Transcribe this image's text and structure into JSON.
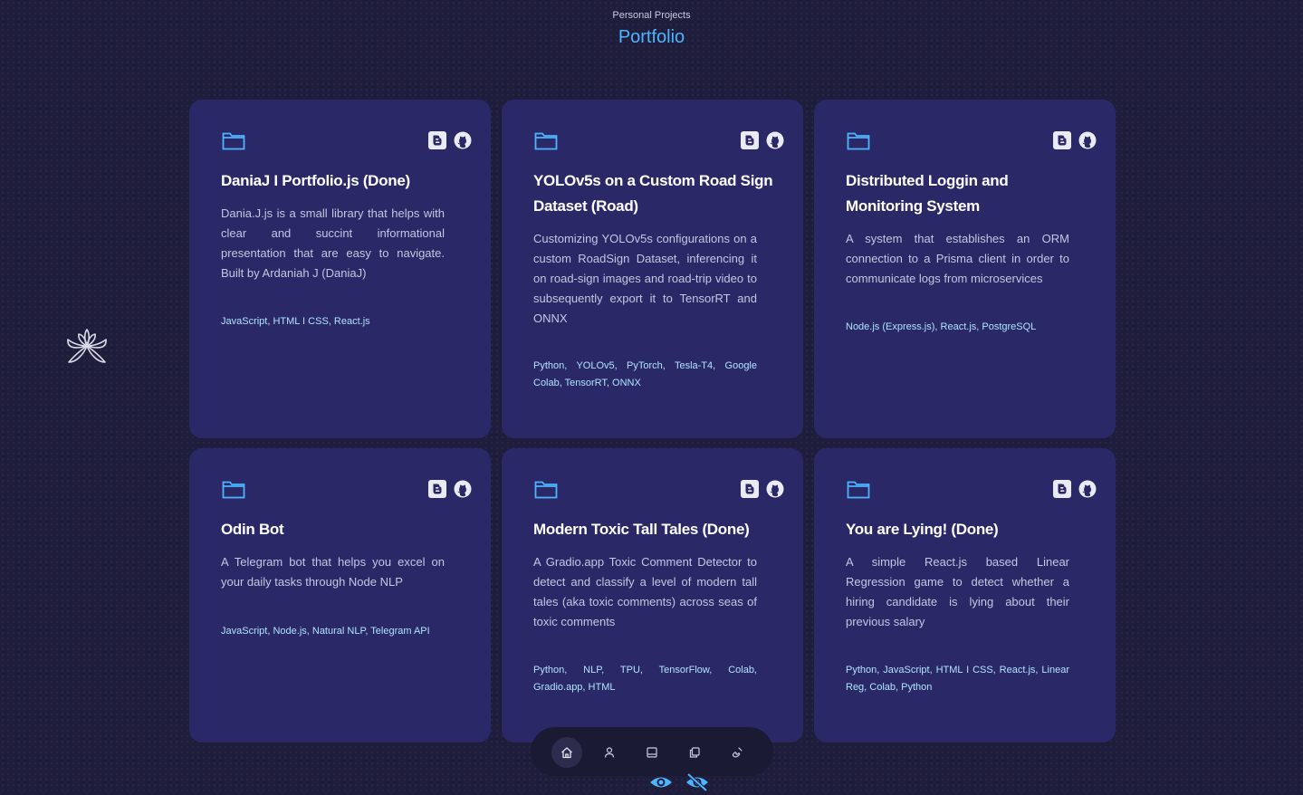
{
  "header": {
    "subtitle": "Personal Projects",
    "title": "Portfolio"
  },
  "colors": {
    "background": "#1f1d3c",
    "card": "#2b2868",
    "accent": "#4db5ff",
    "tech_text": "#aee4ff"
  },
  "logo": {
    "icon": "asterisk-flower-logo"
  },
  "projects": [
    {
      "title": "DaniaJ I Portfolio.js (Done)",
      "description": "Dania.J.js is a small library that helps with clear and succint informational presentation that are easy to navigate. Built by Ardaniah J (DaniaJ)",
      "tech": "JavaScript, HTML I CSS, React.js",
      "icons": [
        "folder-icon",
        "blogger-icon",
        "github-icon"
      ]
    },
    {
      "title": "YOLOv5s on a Custom Road Sign Dataset (Road)",
      "description": "Customizing YOLOv5s configurations on a custom RoadSign Dataset, inferencing it on road-sign images and road-trip video to subsequently export it to TensorRT and ONNX",
      "tech": "Python, YOLOv5, PyTorch, Tesla-T4, Google Colab, TensorRT, ONNX",
      "icons": [
        "folder-icon",
        "blogger-icon",
        "github-icon"
      ]
    },
    {
      "title": "Distributed Loggin and Monitoring System",
      "description": "A system that establishes an ORM connection to a Prisma client in order to communicate logs from microservices",
      "tech": "Node.js (Express.js), React.js, PostgreSQL",
      "icons": [
        "folder-icon",
        "blogger-icon",
        "github-icon"
      ]
    },
    {
      "title": "Odin Bot",
      "description": "A Telegram bot that helps you excel on your daily tasks through Node NLP",
      "tech": "JavaScript, Node.js, Natural NLP, Telegram API",
      "icons": [
        "folder-icon",
        "blogger-icon",
        "github-icon"
      ]
    },
    {
      "title": "Modern Toxic Tall Tales (Done)",
      "description": "A Gradio.app Toxic Comment Detector to detect and classify a level of modern tall tales (aka toxic comments) across seas of toxic comments",
      "tech": "Python, NLP, TPU, TensorFlow, Colab, Gradio.app, HTML",
      "icons": [
        "folder-icon",
        "blogger-icon",
        "github-icon"
      ]
    },
    {
      "title": "You are Lying! (Done)",
      "description": "A simple React.js based Linear Regression game to detect whether a hiring candidate is lying about their previous salary",
      "tech": "Python, JavaScript, HTML I CSS, React.js, Linear Reg, Colab, Python",
      "icons": [
        "folder-icon",
        "blogger-icon",
        "github-icon"
      ]
    }
  ],
  "nav": {
    "items": [
      "home-icon",
      "user-icon",
      "resume-icon",
      "portfolio-icon",
      "contact-icon"
    ],
    "active": "home-icon"
  },
  "visibility_toggles": [
    "eye-icon",
    "eye-off-icon"
  ]
}
